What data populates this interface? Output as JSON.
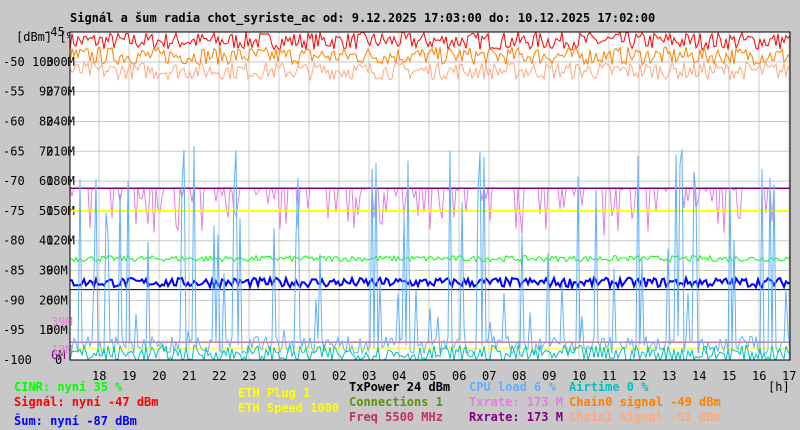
{
  "chart_data": {
    "type": "line",
    "title": "Signál a šum radia chot_syriste_ac od: 9.12.2025 17:03:00 do: 10.12.2025 17:02:00",
    "ylabel": "[dBm] [%]",
    "xlabel": "[h]",
    "ylim": [
      -100,
      -45
    ],
    "y_ticks_dbm": [
      "-45",
      "-50",
      "-55",
      "-60",
      "-65",
      "-70",
      "-75",
      "-80",
      "-85",
      "-90",
      "-95",
      "-100"
    ],
    "y_ticks_pct": [
      "100",
      "90",
      "80",
      "70",
      "60",
      "50",
      "40",
      "30",
      "20",
      "10",
      "0"
    ],
    "y_ticks_rate": [
      "300M",
      "270M",
      "240M",
      "210M",
      "180M",
      "150M",
      "120M",
      "90M",
      "60M",
      "30M",
      "6M"
    ],
    "rate_markers": [
      {
        "label": "39M",
        "color": "#e080e0"
      },
      {
        "label": "13M",
        "color": "#e080e0"
      }
    ],
    "x_ticks": [
      "18",
      "19",
      "20",
      "21",
      "22",
      "23",
      "00",
      "01",
      "02",
      "03",
      "04",
      "05",
      "06",
      "07",
      "08",
      "09",
      "10",
      "11",
      "12",
      "13",
      "14",
      "15",
      "16",
      "17"
    ],
    "series": [
      {
        "name": "Signál",
        "color": "#ff0000",
        "level_dbm": -46.5,
        "spread": 1.5
      },
      {
        "name": "Chain0 signal",
        "color": "#ff8000",
        "level_dbm": -49,
        "spread": 1.5
      },
      {
        "name": "Chain1 signal",
        "color": "#ffa880",
        "level_dbm": -51.5,
        "spread": 1.5
      },
      {
        "name": "CINR",
        "color": "#00ff00",
        "level_dbm": -83,
        "spread": 0.5
      },
      {
        "name": "Šum",
        "color": "#0000ff",
        "level_dbm": -87,
        "spread": 0.8
      },
      {
        "name": "Txrate",
        "color": "#e080e0",
        "level_dbm": -72,
        "spread": 3
      },
      {
        "name": "Rxrate",
        "color": "#800080",
        "level_dbm": -71.2,
        "spread": 0
      },
      {
        "name": "ETH Speed",
        "color": "#ffff00",
        "level_dbm": -75,
        "spread": 0
      },
      {
        "name": "CPU load",
        "color": "#60b0ff",
        "level_dbm": -98,
        "spread": 15
      },
      {
        "name": "Airtime",
        "color": "#00c0c0",
        "level_dbm": -99,
        "spread": 1.5
      }
    ]
  },
  "legend": {
    "cinr": {
      "text": "CINR: nyní 35 %",
      "color": "#00ff00"
    },
    "signal": {
      "text": "Signál: nyní -47 dBm",
      "color": "#ff0000"
    },
    "noise": {
      "text": "Šum: nyní -87 dBm",
      "color": "#0000ff"
    },
    "eth_plug": {
      "text": "ETH Plug 1",
      "color": "#ffff00"
    },
    "eth_speed": {
      "text": "ETH Speed 1000",
      "color": "#ffff00"
    },
    "txpower": {
      "text": "TxPower 24 dBm",
      "color": "#000000"
    },
    "connections": {
      "text": "Connections 1",
      "color": "#609010"
    },
    "freq": {
      "text": "Freq 5500 MHz",
      "color": "#c03060"
    },
    "cpu": {
      "text": "CPU load 6 %",
      "color": "#60b0ff"
    },
    "txrate": {
      "text": "Txrate: 173 M",
      "color": "#e080e0"
    },
    "rxrate": {
      "text": "Rxrate: 173 M",
      "color": "#800080"
    },
    "airtime": {
      "text": "Airtime 0 %",
      "color": "#00c0c0"
    },
    "chain0": {
      "text": "Chain0 signal -49 dBm",
      "color": "#ff8000"
    },
    "chain1": {
      "text": "Chain1 signal -51 dBm",
      "color": "#ffa880"
    }
  }
}
